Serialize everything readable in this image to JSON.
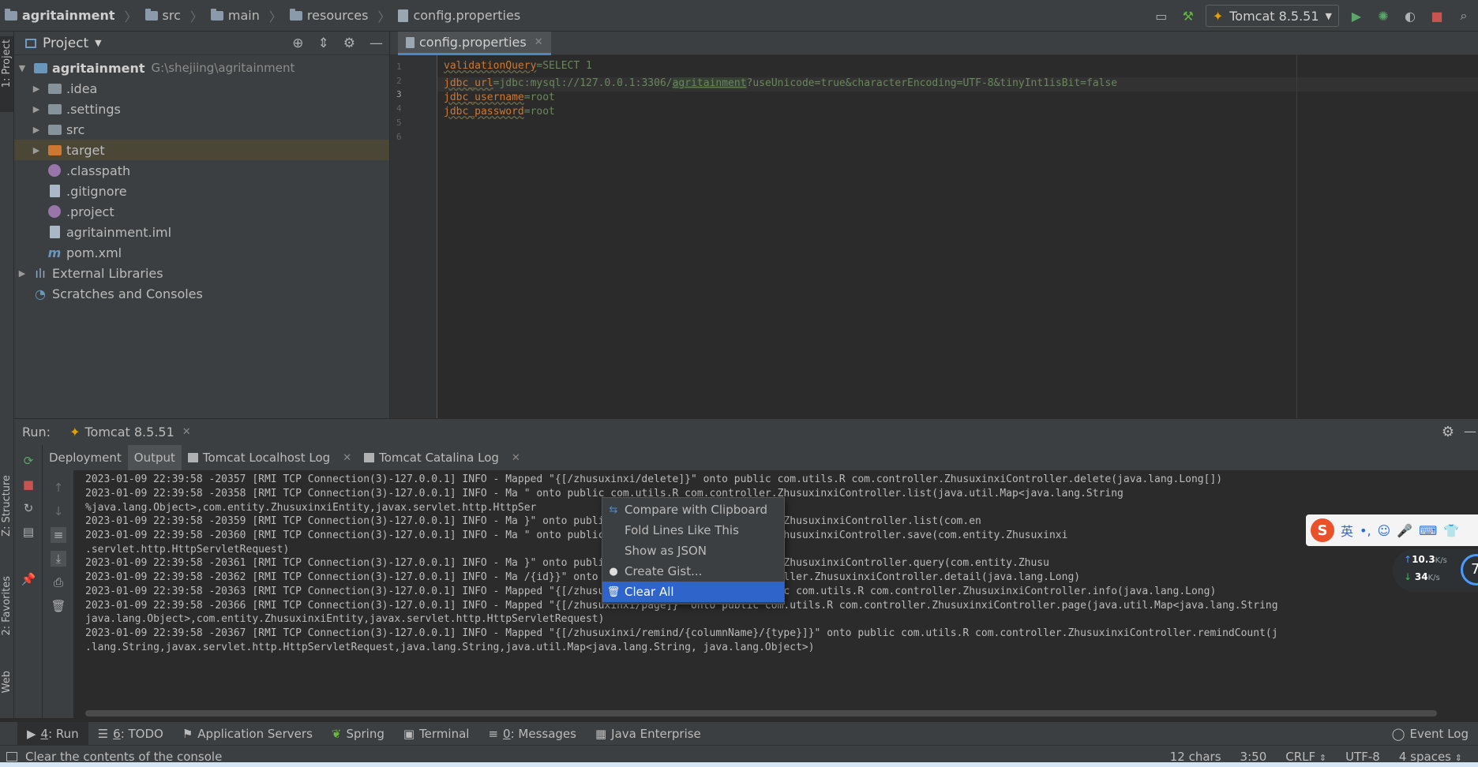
{
  "breadcrumb": {
    "project": "agritainment",
    "items": [
      "src",
      "main",
      "resources",
      "config.properties"
    ]
  },
  "toolbar": {
    "run_config": "Tomcat 8.5.51"
  },
  "left_stripe": {
    "project_label": "1: Project",
    "structure_label": "Z: Structure",
    "favorites_label": "2: Favorites",
    "web_label": "Web"
  },
  "project_panel": {
    "title": "Project",
    "root_name": "agritainment",
    "root_path": "G:\\shejiing\\agritainment",
    "items": [
      ".idea",
      ".settings",
      "src",
      "target",
      ".classpath",
      ".gitignore",
      ".project",
      "agritainment.iml",
      "pom.xml"
    ],
    "external_libraries": "External Libraries",
    "scratches": "Scratches and Consoles"
  },
  "editor": {
    "tab": "config.properties",
    "line_numbers": [
      "1",
      "2",
      "3",
      "4",
      "5",
      "6"
    ],
    "line1_key": "validationQuery",
    "line1_val": "=SELECT 1",
    "line3_key": "jdbc_url",
    "line3_pre": "=jdbc:mysql://127.0.0.1:3306/",
    "line3_hl": "agritainment",
    "line3_post": "?useUnicode=true&characterEncoding=UTF-8&tinyInt1isBit=false",
    "line4_key": "jdbc_username",
    "line4_val": "=root",
    "line5_key": "jdbc_password",
    "line5_val": "=root"
  },
  "run": {
    "label": "Run:",
    "config": "Tomcat 8.5.51",
    "tabs": [
      "Deployment",
      "Output",
      "Tomcat Localhost Log",
      "Tomcat Catalina Log"
    ]
  },
  "console": {
    "lines": [
      "2023-01-09 22:39:58 -20357 [RMI TCP Connection(3)-127.0.0.1] INFO    - Mapped \"{[/zhusuxinxi/delete]}\" onto public com.utils.R com.controller.ZhusuxinxiController.delete(java.lang.Long[])",
      "2023-01-09 22:39:58 -20358 [RMI TCP Connection(3)-127.0.0.1] INFO    - Ma                             \" onto public com.utils.R com.controller.ZhusuxinxiController.list(java.util.Map<java.lang.String",
      "%java.lang.Object>,com.entity.ZhusuxinxiEntity,javax.servlet.http.HttpSer",
      "2023-01-09 22:39:58 -20359 [RMI TCP Connection(3)-127.0.0.1] INFO    - Ma                            }\" onto public com.utils.R com.controller.ZhusuxinxiController.list(com.en",
      "2023-01-09 22:39:58 -20360 [RMI TCP Connection(3)-127.0.0.1] INFO    - Ma                             \" onto public com.utils.R com.controller.ZhusuxinxiController.save(com.entity.Zhusuxinxi",
      " .servlet.http.HttpServletRequest)",
      "2023-01-09 22:39:58 -20361 [RMI TCP Connection(3)-127.0.0.1] INFO    - Ma                            }\" onto public com.utils.R com.controller.ZhusuxinxiController.query(com.entity.Zhusu",
      "2023-01-09 22:39:58 -20362 [RMI TCP Connection(3)-127.0.0.1] INFO    - Ma                     /{id}}\" onto public com.utils.R com.controller.ZhusuxinxiController.detail(java.lang.Long)",
      "2023-01-09 22:39:58 -20363 [RMI TCP Connection(3)-127.0.0.1] INFO    - Mapped \"{[/zhusuxinxi/info/{id}]}\" onto public com.utils.R com.controller.ZhusuxinxiController.info(java.lang.Long)",
      "2023-01-09 22:39:58 -20366 [RMI TCP Connection(3)-127.0.0.1] INFO    - Mapped \"{[/zhusuxinxi/page]}\" onto public com.utils.R com.controller.ZhusuxinxiController.page(java.util.Map<java.lang.String",
      " java.lang.Object>,com.entity.ZhusuxinxiEntity,javax.servlet.http.HttpServletRequest)",
      "2023-01-09 22:39:58 -20367 [RMI TCP Connection(3)-127.0.0.1] INFO    - Mapped \"{[/zhusuxinxi/remind/{columnName}/{type}]}\" onto public com.utils.R com.controller.ZhusuxinxiController.remindCount(j",
      " .lang.String,javax.servlet.http.HttpServletRequest,java.lang.String,java.util.Map<java.lang.String, java.lang.Object>)"
    ]
  },
  "context_menu": {
    "items": [
      "Compare with Clipboard",
      "Fold Lines Like This",
      "Show as JSON",
      "Create Gist...",
      "Clear All"
    ],
    "selected_index": 4
  },
  "ime": {
    "logo": "S",
    "lang": "英",
    "upload": "10.3",
    "upload_unit": "K/s",
    "download": "34",
    "download_unit": "K/s",
    "badge": "7"
  },
  "tool_tabs": [
    {
      "num": "4",
      "label": ": Run"
    },
    {
      "num": "6",
      "label": ": TODO"
    },
    {
      "num": "",
      "label": "Application Servers"
    },
    {
      "num": "",
      "label": "Spring"
    },
    {
      "num": "",
      "label": "Terminal"
    },
    {
      "num": "0",
      "label": ": Messages"
    },
    {
      "num": "",
      "label": "Java Enterprise"
    }
  ],
  "event_log": "Event Log",
  "status": {
    "message": "Clear the contents of the console",
    "chars": "12 chars",
    "position": "3:50",
    "line_sep": "CRLF",
    "encoding": "UTF-8",
    "indent": "4 spaces"
  }
}
